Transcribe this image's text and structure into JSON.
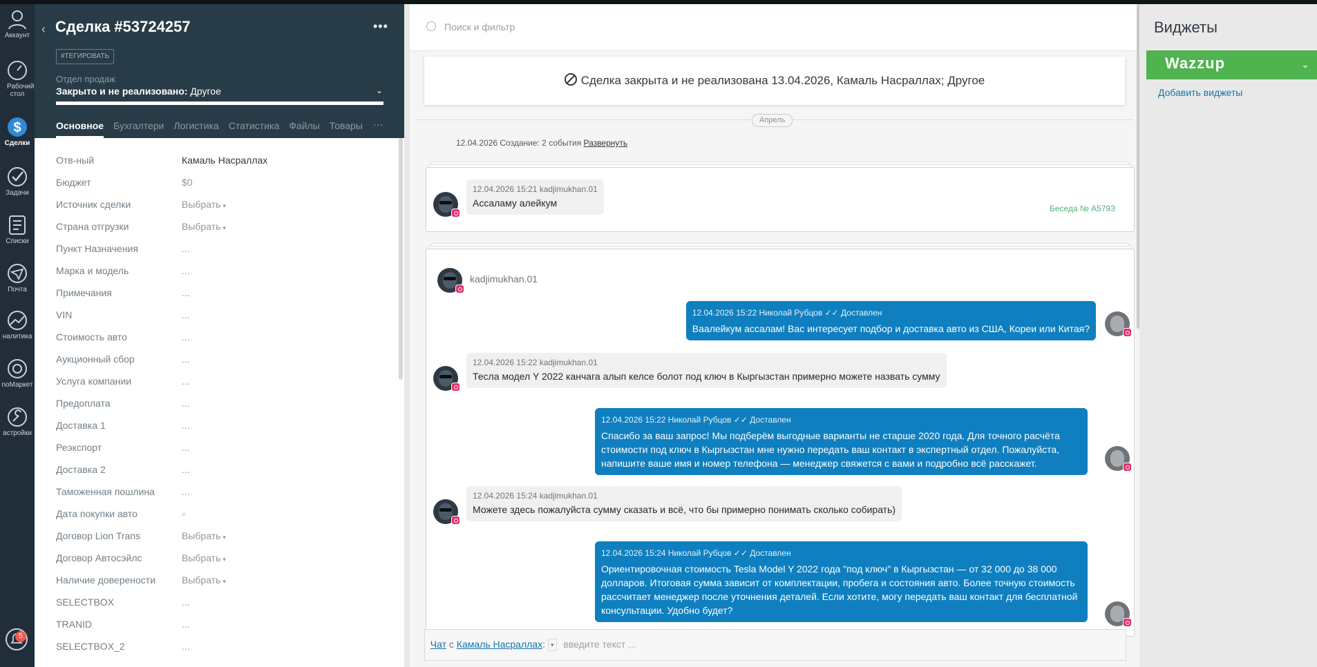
{
  "nav": {
    "items": [
      {
        "label": "Аккаунт"
      },
      {
        "label": "Рабочий стол"
      },
      {
        "label": "Сделки"
      },
      {
        "label": "Задачи"
      },
      {
        "label": "Списки"
      },
      {
        "label": "Почта"
      },
      {
        "label": "налитика"
      },
      {
        "label": "noМаркет"
      },
      {
        "label": "астройки"
      }
    ],
    "notifications_count": "5"
  },
  "deal": {
    "title": "Сделка #53724257",
    "tag_button": "#ТЕГИРОВАТЬ",
    "pipeline_label": "Отдел продаж",
    "status_bold": "Закрыто и не реализовано:",
    "status_reason": "Другое",
    "tabs": [
      "Основное",
      "Бухгалтери",
      "Логистика",
      "Статистика",
      "Файлы",
      "Товары"
    ],
    "tabs_more": "···",
    "fields": [
      {
        "label": "Отв-ный",
        "value": "Камаль Насраллах"
      },
      {
        "label": "Бюджет",
        "value": "$0"
      },
      {
        "label": "Источник сделки",
        "value": "Выбрать"
      },
      {
        "label": "Страна отгрузки",
        "value": "Выбрать"
      },
      {
        "label": "Пункт Назначения",
        "value": "..."
      },
      {
        "label": "Марка и модель",
        "value": "..."
      },
      {
        "label": "Примечания",
        "value": "..."
      },
      {
        "label": "VIN",
        "value": "..."
      },
      {
        "label": "Стоимость авто",
        "value": "..."
      },
      {
        "label": "Аукционный сбор",
        "value": "..."
      },
      {
        "label": "Услуга компании",
        "value": "..."
      },
      {
        "label": "Предоплата",
        "value": "..."
      },
      {
        "label": "Доставка 1",
        "value": "..."
      },
      {
        "label": "Реэкспорт",
        "value": "..."
      },
      {
        "label": "Доставка 2",
        "value": "..."
      },
      {
        "label": "Таможенная пошлина",
        "value": "..."
      },
      {
        "label": "Дата покупки авто",
        "value": "▫"
      },
      {
        "label": "Договор Lion Trans",
        "value": "Выбрать"
      },
      {
        "label": "Договор Автосэйлс",
        "value": "Выбрать"
      },
      {
        "label": "Наличие доверености",
        "value": "Выбрать"
      },
      {
        "label": "SELECTBOX",
        "value": "..."
      },
      {
        "label": "TRANID",
        "value": "..."
      },
      {
        "label": "SELECTBOX_2",
        "value": "..."
      }
    ]
  },
  "feed": {
    "search_placeholder": "Поиск и фильтр",
    "closed_banner": "Сделка закрыта и не реализована 13.04.2026, Камаль Насраллах; Другое",
    "month": "Апрель",
    "created_text": "12.04.2026 Создание: 2 события",
    "expand_link": "Развернуть",
    "first_message": {
      "meta": "12.04.2026 15:21 kadjimukhan.01",
      "text": "Ассаламу алейкум"
    },
    "conversation_link": "Беседа № A5793",
    "talk_user": "kadjimukhan.01",
    "messages": [
      {
        "dir": "out",
        "meta": "12.04.2026 15:22 Николай Рубцов",
        "status": "Доставлен",
        "text": "Ваалейкум ассалам! Вас интересует подбор и доставка авто из США, Кореи или Китая?"
      },
      {
        "dir": "in",
        "meta": "12.04.2026 15:22 kadjimukhan.01",
        "text": "Тесла модел Y 2022 канчага алып келсе болот под ключ в Кыргызстан примерно можете назвать сумму"
      },
      {
        "dir": "out",
        "meta": "12.04.2026 15:22 Николай Рубцов",
        "status": "Доставлен",
        "text": "Спасибо за ваш запрос! Мы подберём выгодные варианты не старше 2020 года. Для точного расчёта стоимости под ключ в Кыргызстан мне нужно передать ваш контакт в экспертный отдел. Пожалуйста, напишите ваше имя и номер телефона — менеджер свяжется с вами и подробно всё расскажет."
      },
      {
        "dir": "in",
        "meta": "12.04.2026 15:24 kadjimukhan.01",
        "text": "Можете здесь пожалуйста сумму сказать и всё, что бы примерно понимать сколько собирать)"
      },
      {
        "dir": "out",
        "meta": "12.04.2026 15:24 Николай Рубцов",
        "status": "Доставлен",
        "text": "Ориентировочная стоимость Tesla Model Y 2022 года \"под ключ\" в Кыргызстан — от 32 000 до 38 000 долларов. Итоговая сумма зависит от комплектации, пробега и состояния авто. Более точную стоимость рассчитает менеджер после уточнения деталей. Если хотите, могу передать ваш контакт для бесплатной консультации. Удобно будет?"
      }
    ],
    "composer": {
      "chat_link": "Чат",
      "with_word": "с",
      "contact_link": "Камаль Насраллах",
      "colon": ":",
      "placeholder": "введите текст ..."
    }
  },
  "widgets": {
    "title": "Виджеты",
    "wazzup": "Wazzup",
    "add_link": "Добавить виджеты"
  },
  "colors": {
    "outgoing_bubble": "#0f7fc0",
    "wazzup_green": "#4fb34f",
    "card_header": "#283c48"
  }
}
